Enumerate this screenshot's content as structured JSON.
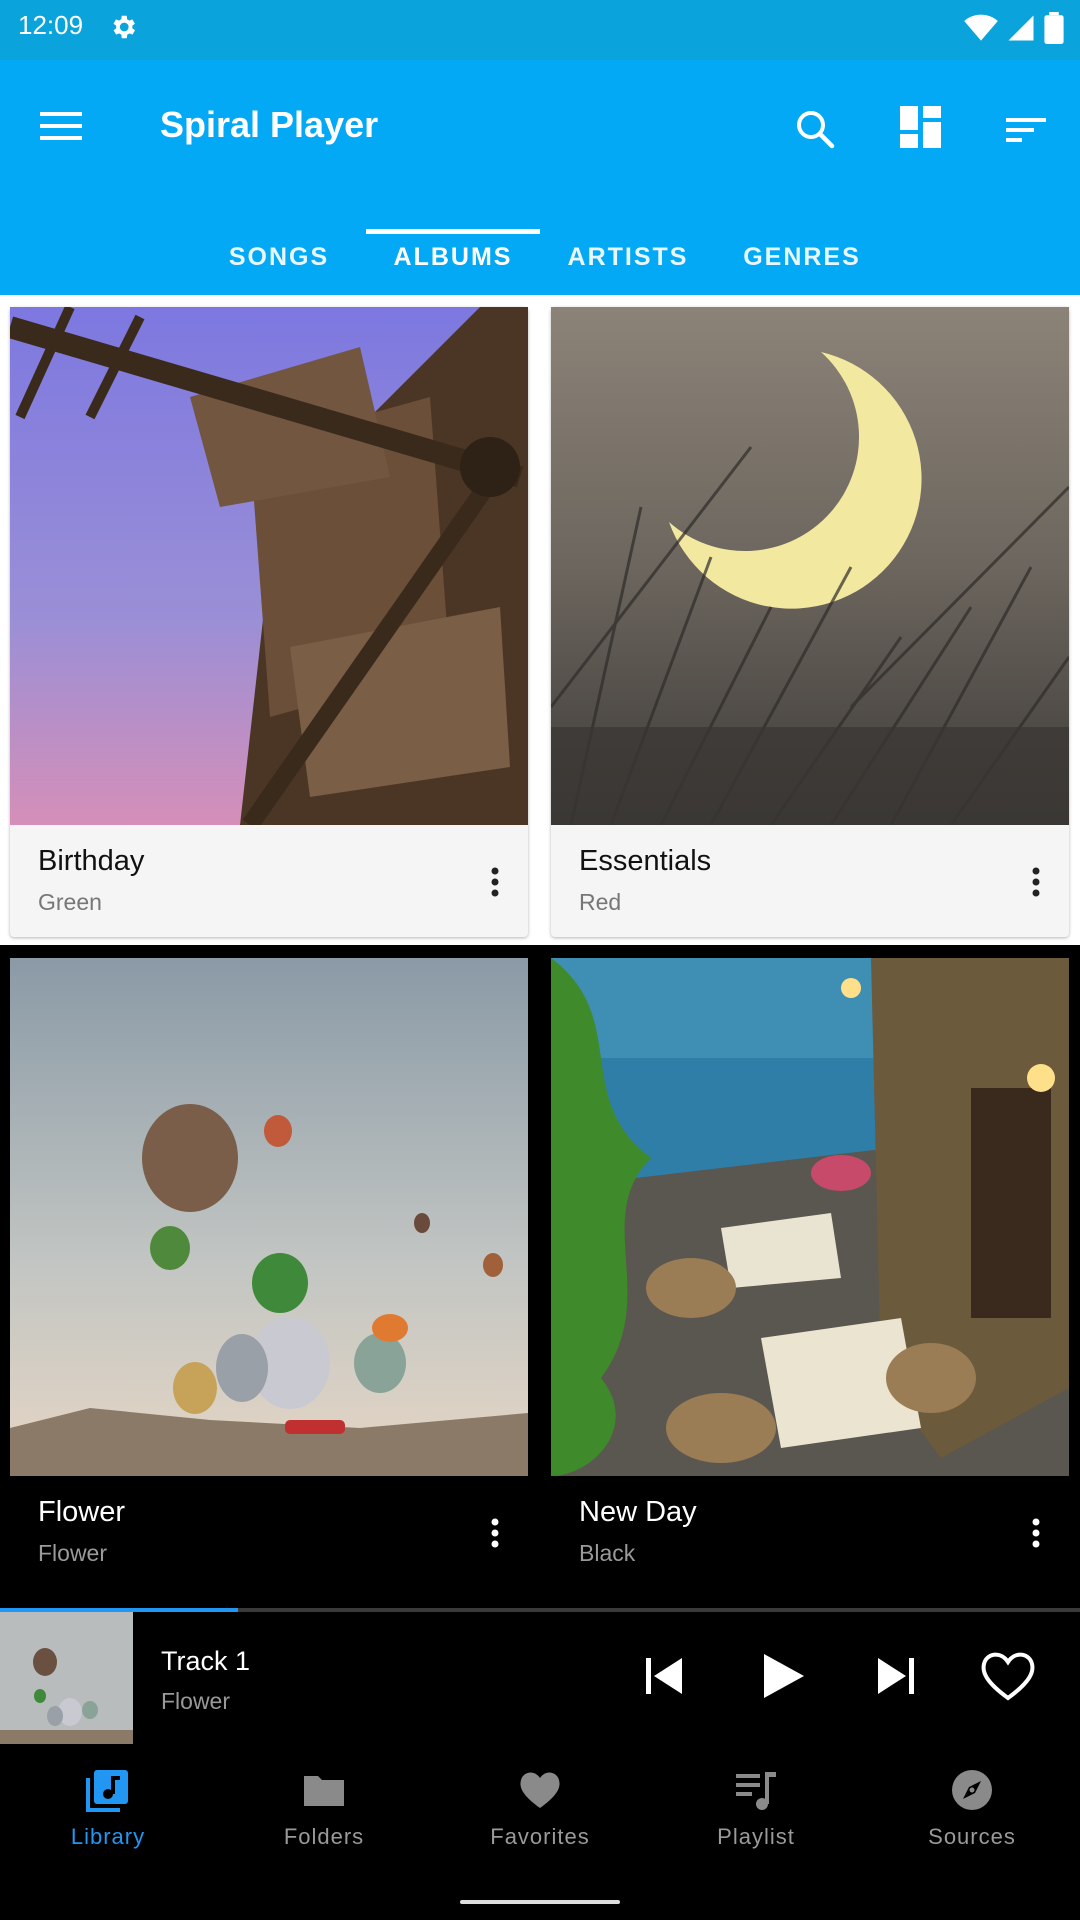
{
  "status": {
    "time": "12:09"
  },
  "appbar": {
    "title": "Spiral Player"
  },
  "tabs": [
    {
      "label": "SONGS"
    },
    {
      "label": "ALBUMS",
      "active": true
    },
    {
      "label": "ARTISTS"
    },
    {
      "label": "GENRES"
    }
  ],
  "albums": [
    {
      "title": "Birthday",
      "subtitle": "Green"
    },
    {
      "title": "Essentials",
      "subtitle": "Red"
    },
    {
      "title": "Flower",
      "subtitle": "Flower"
    },
    {
      "title": "New Day",
      "subtitle": "Black"
    }
  ],
  "player": {
    "track": "Track 1",
    "artist": "Flower",
    "progress": 0.22
  },
  "nav": [
    {
      "label": "Library",
      "active": true
    },
    {
      "label": "Folders"
    },
    {
      "label": "Favorites"
    },
    {
      "label": "Playlist"
    },
    {
      "label": "Sources"
    }
  ],
  "colors": {
    "primary": "#03a9f4",
    "statusbar": "#0ba3dc",
    "accent": "#2196f3"
  }
}
